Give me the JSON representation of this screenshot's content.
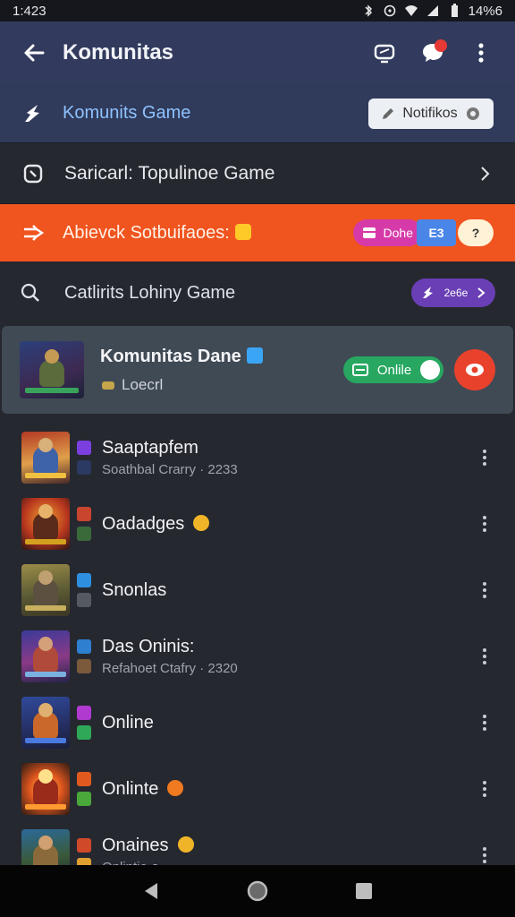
{
  "status_bar": {
    "time": "1:423",
    "battery": "14%6",
    "icons": [
      "bluetooth-icon",
      "alarm-icon",
      "wifi-icon",
      "signal-icon",
      "battery-icon"
    ]
  },
  "app_bar": {
    "title": "Komunitas",
    "icons": [
      "back-arrow-icon",
      "controller-icon",
      "chat-icon",
      "more-vert-icon"
    ]
  },
  "game_bar": {
    "label": "Komunits Game",
    "button": "Notifikos"
  },
  "search_row": {
    "label": "Saricarl: Topulinoe Game"
  },
  "promo": {
    "label": "Abievck Sotbuifaoes:",
    "pill_label": "Dohe",
    "pill_blue": "E3",
    "pill_white": "?"
  },
  "search_row2": {
    "label": "Catlirits Lohiny Game",
    "pill_label": "2e6e"
  },
  "featured": {
    "name": "Komunitas Dane",
    "sub": "Loecrl",
    "online_label": "Onlile"
  },
  "items": [
    {
      "name": "Saaptapfem",
      "meta": "Soathbal Crarry · 2233"
    },
    {
      "name": "Oadadges",
      "meta": ""
    },
    {
      "name": "Snonlas",
      "meta": ""
    },
    {
      "name": "Das Oninis:",
      "meta": "Refahoet Ctafry · 2320"
    },
    {
      "name": "Online",
      "meta": ""
    },
    {
      "name": "Onlinte",
      "meta": ""
    },
    {
      "name": "Onaines",
      "meta": "Onlintie·s"
    }
  ],
  "colors": {
    "app_bar": "#323b5e",
    "promo": "#f0541f",
    "accent_blue": "#8ec2ff",
    "online_green": "#27a760"
  }
}
